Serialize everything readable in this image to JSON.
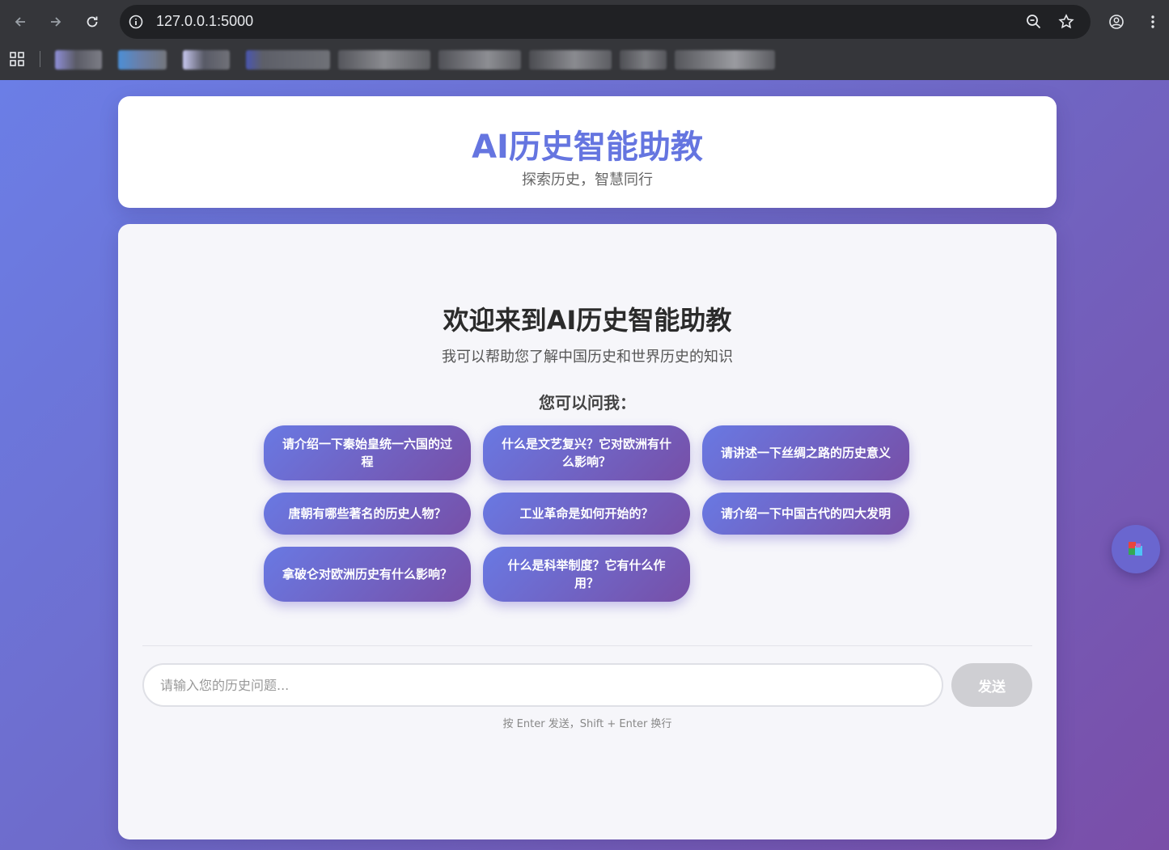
{
  "browser": {
    "url": "127.0.0.1:5000",
    "icons": [
      "back-icon",
      "forward-icon",
      "reload-icon",
      "info-icon",
      "zoom-icon",
      "star-icon",
      "profile-icon",
      "menu-icon",
      "apps-icon"
    ]
  },
  "header": {
    "title": "AI历史智能助教",
    "subtitle": "探索历史，智慧同行"
  },
  "welcome": {
    "title": "欢迎来到AI历史智能助教",
    "description": "我可以帮助您了解中国历史和世界历史的知识",
    "ask_title": "您可以问我："
  },
  "suggestions": [
    "请介绍一下秦始皇统一六国的过程",
    "什么是文艺复兴？它对欧洲有什么影响？",
    "请讲述一下丝绸之路的历史意义",
    "唐朝有哪些著名的历史人物？",
    "工业革命是如何开始的？",
    "请介绍一下中国古代的四大发明",
    "拿破仑对欧洲历史有什么影响？",
    "什么是科举制度？它有什么作用？"
  ],
  "input": {
    "placeholder": "请输入您的历史问题...",
    "value": ""
  },
  "send_label": "发送",
  "hint": "按 Enter 发送，Shift + Enter 换行",
  "colors": {
    "accent": "#6575e0",
    "gradient_start": "#6b7ee6",
    "gradient_end": "#7a4ea8",
    "send_disabled": "#cfcfd3"
  }
}
